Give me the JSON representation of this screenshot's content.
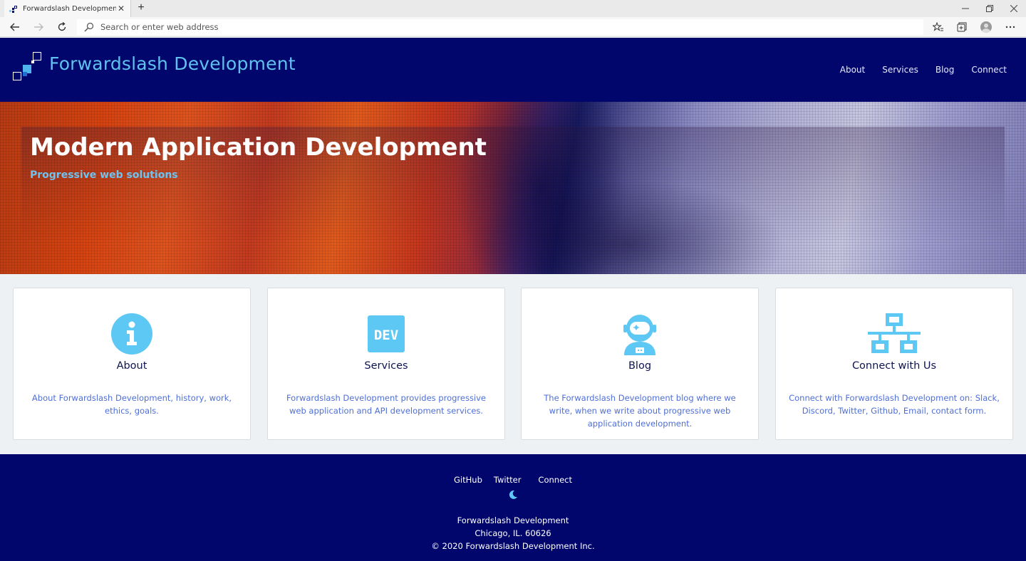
{
  "browser": {
    "tab_title": "Forwardslash Development | Forwardslash Development",
    "address_placeholder": "Search or enter web address"
  },
  "site": {
    "brand": "Forwardslash Development",
    "nav": [
      "About",
      "Services",
      "Blog",
      "Connect"
    ]
  },
  "hero": {
    "title": "Modern Application Development",
    "subtitle": "Progressive web solutions"
  },
  "cards": [
    {
      "title": "About",
      "desc": "About Forwardslash Development, history, work, ethics, goals.",
      "icon": "info-icon"
    },
    {
      "title": "Services",
      "desc": "Forwardslash Development provides progressive web application and API development services.",
      "icon": "dev-icon"
    },
    {
      "title": "Blog",
      "desc": "The Forwardslash Development blog where we write, when we write about progressive web application development.",
      "icon": "astronaut-icon"
    },
    {
      "title": "Connect with Us",
      "desc": "Connect with Forwardslash Development on: Slack, Discord, Twitter, Github, Email, contact form.",
      "icon": "network-icon"
    }
  ],
  "footer": {
    "links": [
      "GitHub",
      "Twitter",
      "Connect"
    ],
    "company": "Forwardslash Development",
    "address": "Chicago, IL. 60626",
    "copyright": "© 2020 Forwardslash Development Inc."
  },
  "colors": {
    "header_bg": "#00066b",
    "accent": "#5fc1ee",
    "card_text": "#4f6fd6"
  }
}
